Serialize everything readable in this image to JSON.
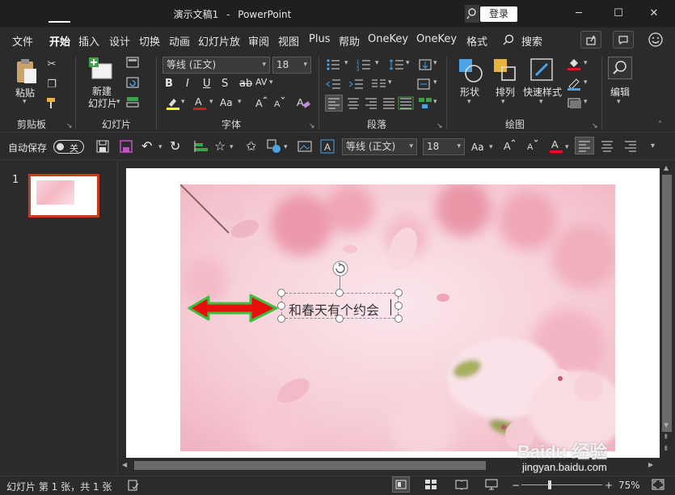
{
  "titlebar": {
    "doc_name": "演示文稿1",
    "separator": "-",
    "app_name": "PowerPoint",
    "login": "登录"
  },
  "window_controls": {
    "minimize": "─",
    "maximize": "☐",
    "close": "✕"
  },
  "menu": {
    "tabs": [
      "文件",
      "开始",
      "插入",
      "设计",
      "切换",
      "动画",
      "幻灯片放",
      "审阅",
      "视图",
      "Plus",
      "帮助",
      "OneKey",
      "OneKey",
      "格式"
    ],
    "active": "开始",
    "search": "搜索"
  },
  "ribbon": {
    "clipboard": {
      "paste": "粘贴",
      "label": "剪贴板"
    },
    "slides": {
      "new_slide": "新建",
      "new_slide_2": "幻灯片",
      "label": "幻灯片"
    },
    "font": {
      "font_name": "等线 (正文)",
      "font_size": "18",
      "bold": "B",
      "italic": "I",
      "underline": "U",
      "shadow": "S",
      "strike": "ab",
      "spacing": "AV",
      "change_case": "Aa",
      "label": "字体"
    },
    "paragraph": {
      "label": "段落"
    },
    "drawing": {
      "shape": "形状",
      "arrange": "排列",
      "quick_style": "快速样式",
      "label": "绘图"
    },
    "editing": {
      "label": "编辑"
    }
  },
  "qat": {
    "autosave": "自动保存",
    "toggle": "关",
    "font_name": "等线 (正文)",
    "font_size": "18",
    "change_case": "Aa"
  },
  "thumbnails": {
    "slide_number": "1"
  },
  "slide": {
    "text": "和春天有个约会"
  },
  "statusbar": {
    "slide_info": "幻灯片 第 1 张，共 1 张",
    "zoom": "75%"
  },
  "watermark": {
    "brand": "Baidu 经验",
    "url": "jingyan.baidu.com"
  },
  "colors": {
    "accent_red": "#c43e1c",
    "font_red": "#e81123",
    "highlight_yellow": "#ffff00"
  }
}
